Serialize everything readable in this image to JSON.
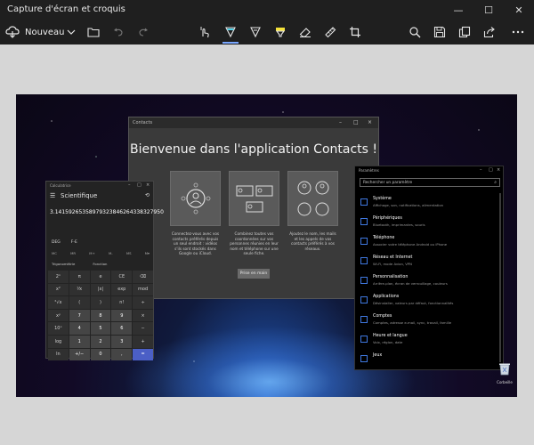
{
  "window": {
    "title": "Capture d'écran et croquis",
    "minimize": "—",
    "maximize": "☐",
    "close": "✕"
  },
  "toolbar": {
    "new_label": "Nouveau",
    "accent_color": "#7aa7ff",
    "icons": [
      "snip-icon",
      "chevron-down-icon",
      "folder-icon",
      "undo-icon",
      "redo-icon",
      "touch-writing-icon",
      "ballpoint-pen-icon",
      "pencil-icon",
      "highlighter-icon",
      "eraser-icon",
      "ruler-icon",
      "crop-icon",
      "zoom-icon",
      "save-icon",
      "copy-icon",
      "share-icon",
      "more-icon"
    ]
  },
  "screenshot": {
    "contacts": {
      "titlebar": "Contacts",
      "headline": "Bienvenue dans l'application Contacts !",
      "descriptions": [
        "Connectez-vous avec vos contacts préférés depuis un seul endroit : vidéos s'ils sont stockés dans Google ou iCloud.",
        "Combinez toutes vos coordonnées sur vos personnes réunies en leur nom et téléphone sur une seule fiche.",
        "Ajoutez le nom, les mails et les appels de vos contacts préférés à vos réseaux."
      ],
      "start_button": "Prise en main"
    },
    "calculator": {
      "titlebar": "Calculatrice",
      "menu_icon": "☰",
      "mode": "Scientifique",
      "history_icon": "⟲",
      "display": "3.14159265358979323846264338327950",
      "deg": "DEG",
      "fe": "F-E",
      "memory": [
        "MC",
        "MR",
        "M+",
        "M-",
        "MS",
        "M▾"
      ],
      "trig": "Trigonométrie",
      "func": "Fonction",
      "keys": [
        "2ⁿ",
        "π",
        "e",
        "CE",
        "⌫",
        "x²",
        "⅟x",
        "|x|",
        "exp",
        "mod",
        "²√x",
        "(",
        ")",
        "n!",
        "÷",
        "xʸ",
        "7",
        "8",
        "9",
        "×",
        "10ˣ",
        "4",
        "5",
        "6",
        "−",
        "log",
        "1",
        "2",
        "3",
        "+",
        "ln",
        "+/−",
        "0",
        ",",
        "="
      ]
    },
    "settings": {
      "titlebar": "Paramètres",
      "search_placeholder": "Rechercher un paramètre",
      "items": [
        {
          "name": "Système",
          "sub": "Affichage, son, notifications, alimentation"
        },
        {
          "name": "Périphériques",
          "sub": "Bluetooth, imprimantes, souris"
        },
        {
          "name": "Téléphone",
          "sub": "Associer votre téléphone Android ou iPhone"
        },
        {
          "name": "Réseau et Internet",
          "sub": "Wi-Fi, mode Avion, VPN"
        },
        {
          "name": "Personnalisation",
          "sub": "Arrière-plan, écran de verrouillage, couleurs"
        },
        {
          "name": "Applications",
          "sub": "Désinstaller, valeurs par défaut, fonctionnalités"
        },
        {
          "name": "Comptes",
          "sub": "Comptes, adresse e-mail, sync, travail, famille"
        },
        {
          "name": "Heure et langue",
          "sub": "Voix, région, date"
        },
        {
          "name": "Jeux",
          "sub": ""
        }
      ]
    },
    "desktop": {
      "recycle_bin_label": "Corbeille"
    }
  }
}
